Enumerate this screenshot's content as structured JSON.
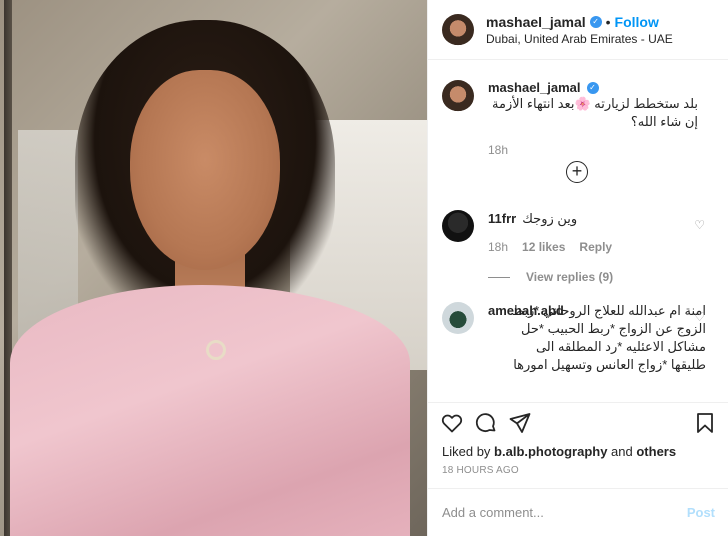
{
  "post": {
    "username": "mashael_jamal",
    "follow_label": "Follow",
    "separator": "•",
    "location": "Dubai, United Arab Emirates - UAE",
    "verified_glyph": "✓"
  },
  "caption": {
    "username": "mashael_jamal",
    "text": "بلد ستخطط لزيارته 🌸بعد انتهاء الأزمة إن شاء الله؟",
    "time": "18h"
  },
  "load_more": {
    "glyph": "+"
  },
  "comments": [
    {
      "username": "11frr",
      "text": "وين زوجك",
      "time": "18h",
      "likes": "12 likes",
      "reply": "Reply",
      "view_replies": "View replies (9)"
    },
    {
      "username": "amenah.abd",
      "text": "امنة ام عبدالله للعلاج الروحاني *ربط الزوج عن الزواج *ربط الحبيب *حل مشاكل الاعئليه *رد المطلقه الى طليقها *زواج العانس وتسهيل امورها"
    }
  ],
  "footer": {
    "liked_prefix": "Liked by ",
    "liked_user": "b.alb.photography",
    "liked_mid": " and ",
    "liked_others": "others",
    "timestamp": "18 HOURS AGO",
    "add_comment_placeholder": "Add a comment...",
    "post_label": "Post"
  },
  "colors": {
    "accent": "#0095f6",
    "verified": "#3897f0",
    "muted": "#8e8e8e",
    "post_disabled": "#b2dffc"
  }
}
